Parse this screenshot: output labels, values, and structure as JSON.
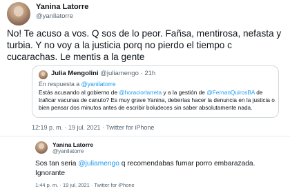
{
  "tweet": {
    "author_name": "Yanina Latorre",
    "author_handle": "@yanilatorre",
    "text": "No! Te acuso a vos. Q sos de lo peor. Fañsa, mentirosa, nefasta y turbia. Y no voy a la justicia porq no pierdo el tiempo c cucarachas. Le mentis a la gente",
    "meta": "12:19 p. m. · 19 jul. 2021 · Twitter for iPhone"
  },
  "quoted": {
    "author_name": "Julia Mengolini",
    "author_handle": "@juliamengo",
    "time": "21h",
    "reply_prefix": "En respuesta a ",
    "reply_to": "@yanilatorre",
    "text_parts": [
      "Estás acusando al gobierno de ",
      "@horaciorlarreta",
      " y a la gestión de ",
      "@FernanQuirosBA",
      " de traficar vacunas de canuto? Es muy grave Yanina, deberías hacer la denuncia en la justicia o bien pensar dos minutos antes de escribir boludeces sin saber absolutamente nada."
    ]
  },
  "reply": {
    "author_name": "Yanina Latorre",
    "author_handle": "@yanilatorre",
    "text_before": "Sos tan seria ",
    "mention": "@juliamengo",
    "text_after": " q recomendabas fumar porro embarazada. Ignorante",
    "meta": "1:44 p. m. · 19 jul. 2021 · Twitter for iPhone"
  },
  "colors": {
    "link": "#1d9bf0",
    "secondary_text": "#536471",
    "border": "#cfd9de"
  }
}
